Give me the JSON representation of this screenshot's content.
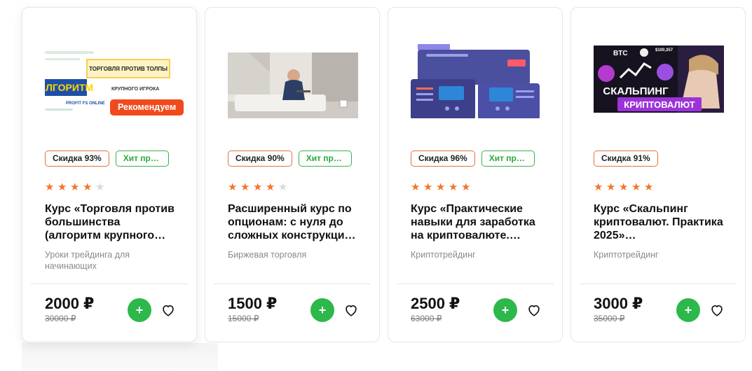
{
  "cards": [
    {
      "badge_discount": "Скидка 93%",
      "badge_hit": "Хит продаж",
      "recommend": "Рекомендуем",
      "rating": 4,
      "title": "Курс «Торговля против большинства (алгоритм крупного…",
      "category": "Уроки трейдинга для начинающих",
      "price": "2000 ₽",
      "old_price": "30000 ₽",
      "image_text": {
        "line1": "ТОРГОВЛЯ ПРОТИВ ТОЛПЫ",
        "line2": "АЛГОРИТМ",
        "line3": "КРУПНОГО ИГРОКА",
        "line4": "PROFIT FS ONLINE"
      }
    },
    {
      "badge_discount": "Скидка 90%",
      "badge_hit": "Хит продаж",
      "rating": 4,
      "title": "Расширенный курс по опционам: с нуля до сложных конструкци…",
      "category": "Биржевая торговля",
      "price": "1500 ₽",
      "old_price": "15000 ₽"
    },
    {
      "badge_discount": "Скидка 96%",
      "badge_hit": "Хит продаж",
      "rating": 5,
      "title": "Курс «Практические навыки для заработка на криптовалюте.…",
      "category": "Криптотрейдинг",
      "price": "2500 ₽",
      "old_price": "63000 ₽"
    },
    {
      "badge_discount": "Скидка 91%",
      "rating": 5,
      "title": "Курс «Скальпинг криптовалют. Практика 2025»…",
      "category": "Криптотрейдинг",
      "price": "3000 ₽",
      "old_price": "35000 ₽",
      "image_text": {
        "line1": "BTC",
        "line2": "СКАЛЬПИНГ",
        "line3": "КРИПТОВАЛЮТ",
        "line4": "$100,357"
      }
    }
  ],
  "icons": {
    "add": "+",
    "star": "★",
    "favorite": "heart-icon"
  },
  "colors": {
    "accent_orange": "#f04a1d",
    "star": "#f2742d",
    "green": "#2cb84a",
    "discount_border": "#e0743a"
  }
}
